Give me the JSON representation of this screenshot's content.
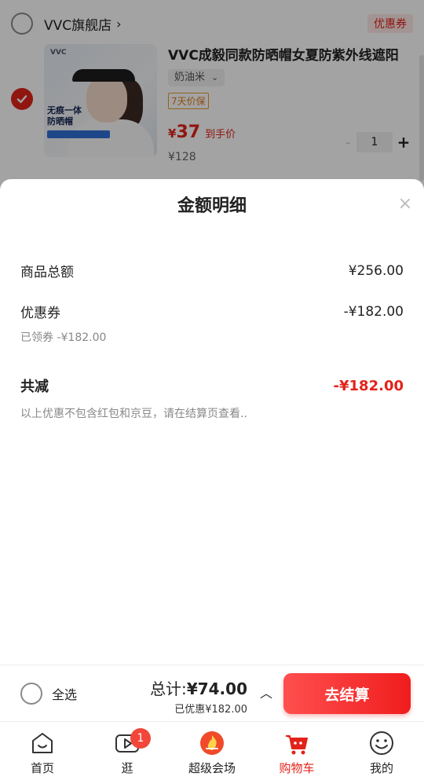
{
  "store": {
    "name": "VVC旗舰店",
    "chevron": "›",
    "coupon_tag": "优惠券"
  },
  "product": {
    "title": "VVC成毅同款防晒帽女夏防紫外线遮阳",
    "spec": "奶油米",
    "guarantee": "7天价保",
    "price_symbol": "¥",
    "price": "37",
    "price_after": "到手价",
    "orig_price": "¥128",
    "quantity": "1",
    "minus": "-",
    "plus": "+",
    "image": {
      "logo": "VVC",
      "promo": "无痕一体\n防晒帽"
    }
  },
  "sheet": {
    "title": "金额明细",
    "close": "×",
    "rows": [
      {
        "label": "商品总额",
        "amount": "¥256.00"
      },
      {
        "label": "优惠券",
        "amount": "-¥182.00"
      }
    ],
    "coupon_note": "已领券 -¥182.00",
    "total_label": "共减",
    "total_amount": "-¥182.00",
    "disclaimer": "以上优惠不包含红包和京豆，请在结算页查看.."
  },
  "checkout": {
    "select_all": "全选",
    "total_prefix": "总计:",
    "total_amount": "¥74.00",
    "discount": "已优惠¥182.00",
    "caret": "︿",
    "button": "去结算"
  },
  "tabs": [
    {
      "label": "首页",
      "icon": "home-icon"
    },
    {
      "label": "逛",
      "icon": "video-icon",
      "badge": "1"
    },
    {
      "label": "超级会场",
      "icon": "flame-icon"
    },
    {
      "label": "购物车",
      "icon": "cart-icon"
    },
    {
      "label": "我的",
      "icon": "smile-icon"
    }
  ],
  "colors": {
    "accent": "#e2231a",
    "checkout_btn": "#f01d1d",
    "badge": "#f2463b"
  }
}
